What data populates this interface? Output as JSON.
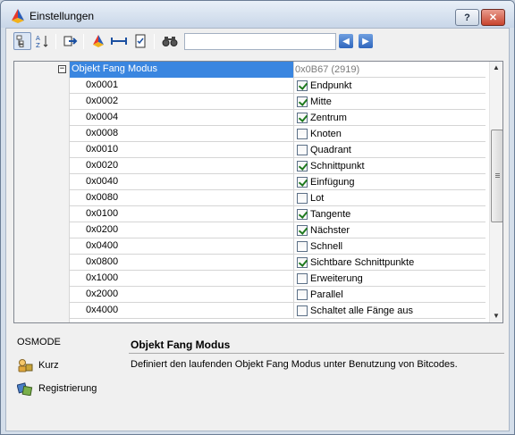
{
  "window": {
    "title": "Einstellungen",
    "help_label": "?",
    "close_label": "✕"
  },
  "toolbar": {
    "icons": [
      "categorized-icon",
      "alphabetical-icon",
      "export-icon",
      "import-icon",
      "range-icon",
      "checklist-icon",
      "find-icon",
      "previous-icon",
      "next-icon"
    ],
    "search_value": "",
    "prev_label": "◀",
    "next_label": "▶"
  },
  "grid": {
    "header": {
      "key": "Objekt Fang Modus",
      "value": "0x0B67 (2919)"
    },
    "rows": [
      {
        "key": "0x0001",
        "label": "Endpunkt",
        "checked": true
      },
      {
        "key": "0x0002",
        "label": "Mitte",
        "checked": true
      },
      {
        "key": "0x0004",
        "label": "Zentrum",
        "checked": true
      },
      {
        "key": "0x0008",
        "label": "Knoten",
        "checked": false
      },
      {
        "key": "0x0010",
        "label": "Quadrant",
        "checked": false
      },
      {
        "key": "0x0020",
        "label": "Schnittpunkt",
        "checked": true
      },
      {
        "key": "0x0040",
        "label": "Einfügung",
        "checked": true
      },
      {
        "key": "0x0080",
        "label": "Lot",
        "checked": false
      },
      {
        "key": "0x0100",
        "label": "Tangente",
        "checked": true
      },
      {
        "key": "0x0200",
        "label": "Nächster",
        "checked": true
      },
      {
        "key": "0x0400",
        "label": "Schnell",
        "checked": false
      },
      {
        "key": "0x0800",
        "label": "Sichtbare Schnittpunkte",
        "checked": true
      },
      {
        "key": "0x1000",
        "label": "Erweiterung",
        "checked": false
      },
      {
        "key": "0x2000",
        "label": "Parallel",
        "checked": false
      },
      {
        "key": "0x4000",
        "label": "Schaltet alle Fänge aus",
        "checked": false
      }
    ]
  },
  "side": {
    "variable": "OSMODE",
    "items": [
      {
        "label": "Kurz",
        "icon": "lock-user-icon"
      },
      {
        "label": "Registrierung",
        "icon": "registry-icon"
      }
    ]
  },
  "description": {
    "title": "Objekt Fang Modus",
    "text": "Definiert den laufenden Objekt Fang Modus unter Benutzung von Bitcodes."
  },
  "colors": {
    "selection": "#3a86e0",
    "check": "#1f7a1f"
  }
}
